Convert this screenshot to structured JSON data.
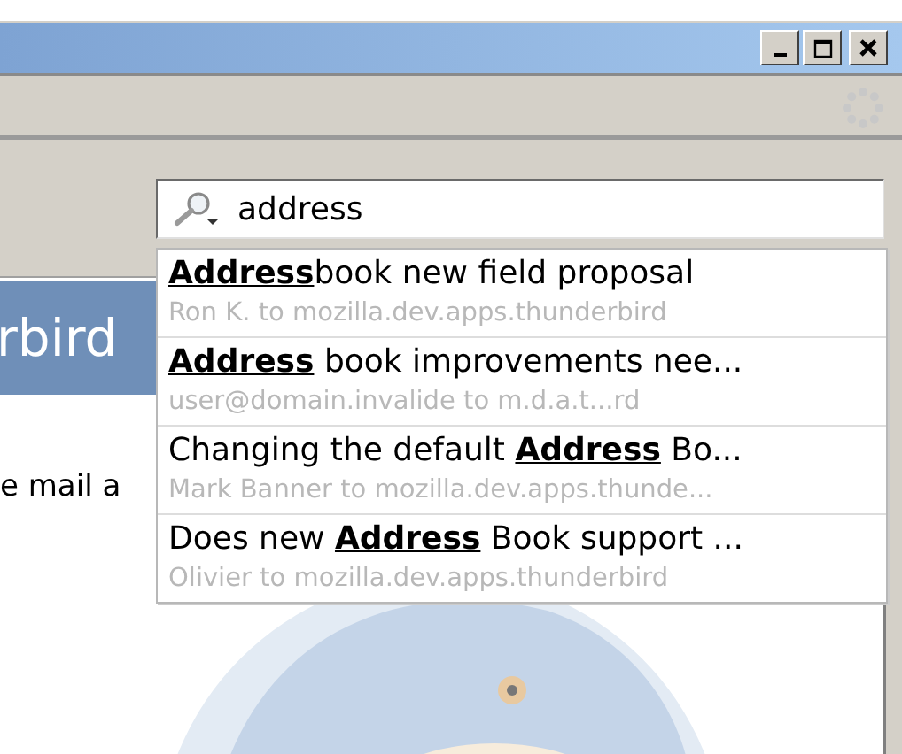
{
  "search": {
    "value": "address"
  },
  "results": [
    {
      "subject": "**Address**book new field proposal",
      "from": "Ron K. to mozilla.dev.apps.thunderbird"
    },
    {
      "subject": "**Address** book improvements nee...",
      "from": "user@domain.invalide to m.d.a.t...rd"
    },
    {
      "subject": "Changing the default **Address** Bo...",
      "from": "Mark Banner to mozilla.dev.apps.thunde..."
    },
    {
      "subject": "Does new **Address** Book support ...",
      "from": "Olivier to mozilla.dev.apps.thunderbird"
    }
  ],
  "content": {
    "banner": "rbird",
    "text": "e mail a"
  }
}
